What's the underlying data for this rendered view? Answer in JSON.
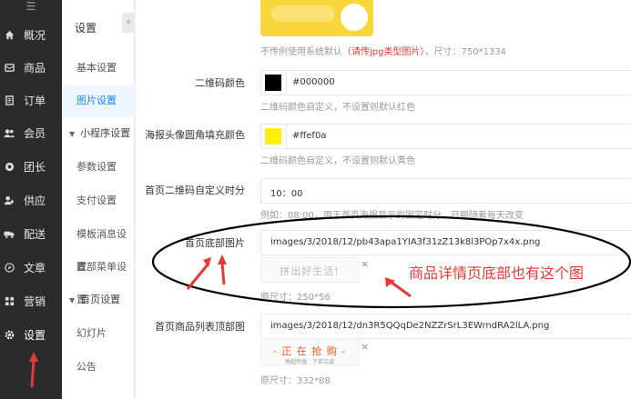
{
  "rail": {
    "menu_glyph": "☰",
    "items": [
      {
        "label": "概况",
        "icon": "home-icon"
      },
      {
        "label": "商品",
        "icon": "goods-icon"
      },
      {
        "label": "订单",
        "icon": "order-icon"
      },
      {
        "label": "会员",
        "icon": "members-icon"
      },
      {
        "label": "团长",
        "icon": "leader-icon"
      },
      {
        "label": "供应",
        "icon": "supply-icon"
      },
      {
        "label": "配送",
        "icon": "truck-icon"
      },
      {
        "label": "文章",
        "icon": "compass-icon"
      },
      {
        "label": "营销",
        "icon": "marketing-icon"
      },
      {
        "label": "设置",
        "icon": "gear-icon"
      }
    ]
  },
  "menu": {
    "title": "设置",
    "collapse_glyph": "«",
    "items": [
      "基本设置",
      "图片设置"
    ],
    "group1": "小程序设置",
    "group1_items": [
      "参数设置",
      "支付设置",
      "模板消息设置",
      "底部菜单设置"
    ],
    "group2": "首页设置",
    "group2_items": [
      "幻灯片",
      "公告"
    ]
  },
  "content": {
    "top_help_prefix": "不传例使用系统默认",
    "top_help_red": "（请传jpg类型图片）",
    "top_help_suffix": "，尺寸：750*1334",
    "qr_color": {
      "label": "二维码颜色",
      "value": "#000000",
      "help": "二维码颜色自定义，不设置则默认红色",
      "swatch": "#000000"
    },
    "avatar_fill": {
      "label": "海报头像圆角填充颜色",
      "value": "#ffef0a",
      "help": "二维码颜色自定义，不设置则默认黄色",
      "swatch": "#ffef0a"
    },
    "qr_time": {
      "label": "首页二维码自定义时分",
      "value": "10：00",
      "help": "例如：08:00，用于首页海报显示的固定时分，日期随着每天改变"
    },
    "bottom_img": {
      "label": "首页底部图片",
      "value": "images/3/2018/12/pb43apa1YIA3f31zZ13k8l3POp7x4x.png",
      "preview": "拼出好生活!",
      "close": "×",
      "size": "原尺寸：250*56"
    },
    "list_top_img": {
      "label": "首页商品列表顶部图",
      "value": "images/3/2018/12/dn3R5QQqDe2NZZrSrL3EWrndRA2lLA.png",
      "preview": "- 正 在 抢 购 -",
      "preview_sub": "物超所值 · 下单立减",
      "close": "×",
      "size": "原尺寸：332*88"
    }
  },
  "annotation": {
    "note": "商品详情页底部也有这个图",
    "color": "#e53935"
  }
}
